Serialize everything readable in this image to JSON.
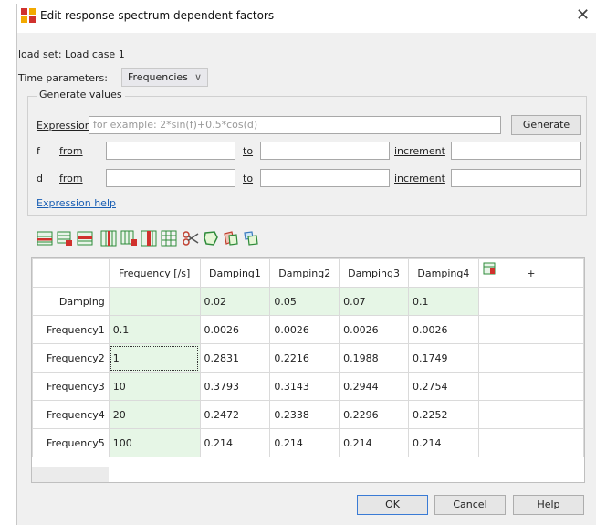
{
  "window": {
    "title": "Edit response spectrum dependent factors",
    "close_glyph": "✕"
  },
  "load_set": "load set: Load case 1",
  "time_params": {
    "label": "Time parameters:",
    "value": "Frequencies",
    "arrow": "∨"
  },
  "generate": {
    "legend": "Generate values",
    "expression": {
      "label": "Expression",
      "placeholder": "for example: 2*sin(f)+0.5*cos(d)",
      "button": "Generate"
    },
    "rows": [
      {
        "var": "f",
        "from": "from",
        "to": "to",
        "increment": "increment"
      },
      {
        "var": "d",
        "from": "from",
        "to": "to",
        "increment": "increment"
      }
    ],
    "help_link": "Expression help"
  },
  "toolbar": {
    "icons": [
      "insert-row-icon",
      "append-row-icon",
      "delete-row-icon",
      "insert-column-icon",
      "append-column-icon",
      "delete-column-icon",
      "clear-table-icon",
      "cut-icon",
      "copy-icon",
      "paste-icon",
      "paste-special-icon"
    ]
  },
  "grid": {
    "headers": [
      "",
      "Frequency [/s]",
      "Damping1",
      "Damping2",
      "Damping3",
      "Damping4",
      "+"
    ],
    "damping_row": {
      "label": "Damping",
      "values": [
        "0.02",
        "0.05",
        "0.07",
        "0.1"
      ]
    },
    "rows": [
      {
        "label": "Frequency1",
        "freq": "0.1",
        "values": [
          "0.0026",
          "0.0026",
          "0.0026",
          "0.0026"
        ]
      },
      {
        "label": "Frequency2",
        "freq": "1",
        "values": [
          "0.2831",
          "0.2216",
          "0.1988",
          "0.1749"
        ]
      },
      {
        "label": "Frequency3",
        "freq": "10",
        "values": [
          "0.3793",
          "0.3143",
          "0.2944",
          "0.2754"
        ]
      },
      {
        "label": "Frequency4",
        "freq": "20",
        "values": [
          "0.2472",
          "0.2338",
          "0.2296",
          "0.2252"
        ]
      },
      {
        "label": "Frequency5",
        "freq": "100",
        "values": [
          "0.214",
          "0.214",
          "0.214",
          "0.214"
        ]
      }
    ]
  },
  "buttons": {
    "ok": "OK",
    "cancel": "Cancel",
    "help": "Help"
  },
  "colors": {
    "accent_green": "#e6f6e6",
    "link": "#1a5fb4",
    "icon_red": "#d0312d",
    "icon_green": "#2e8b3a"
  }
}
